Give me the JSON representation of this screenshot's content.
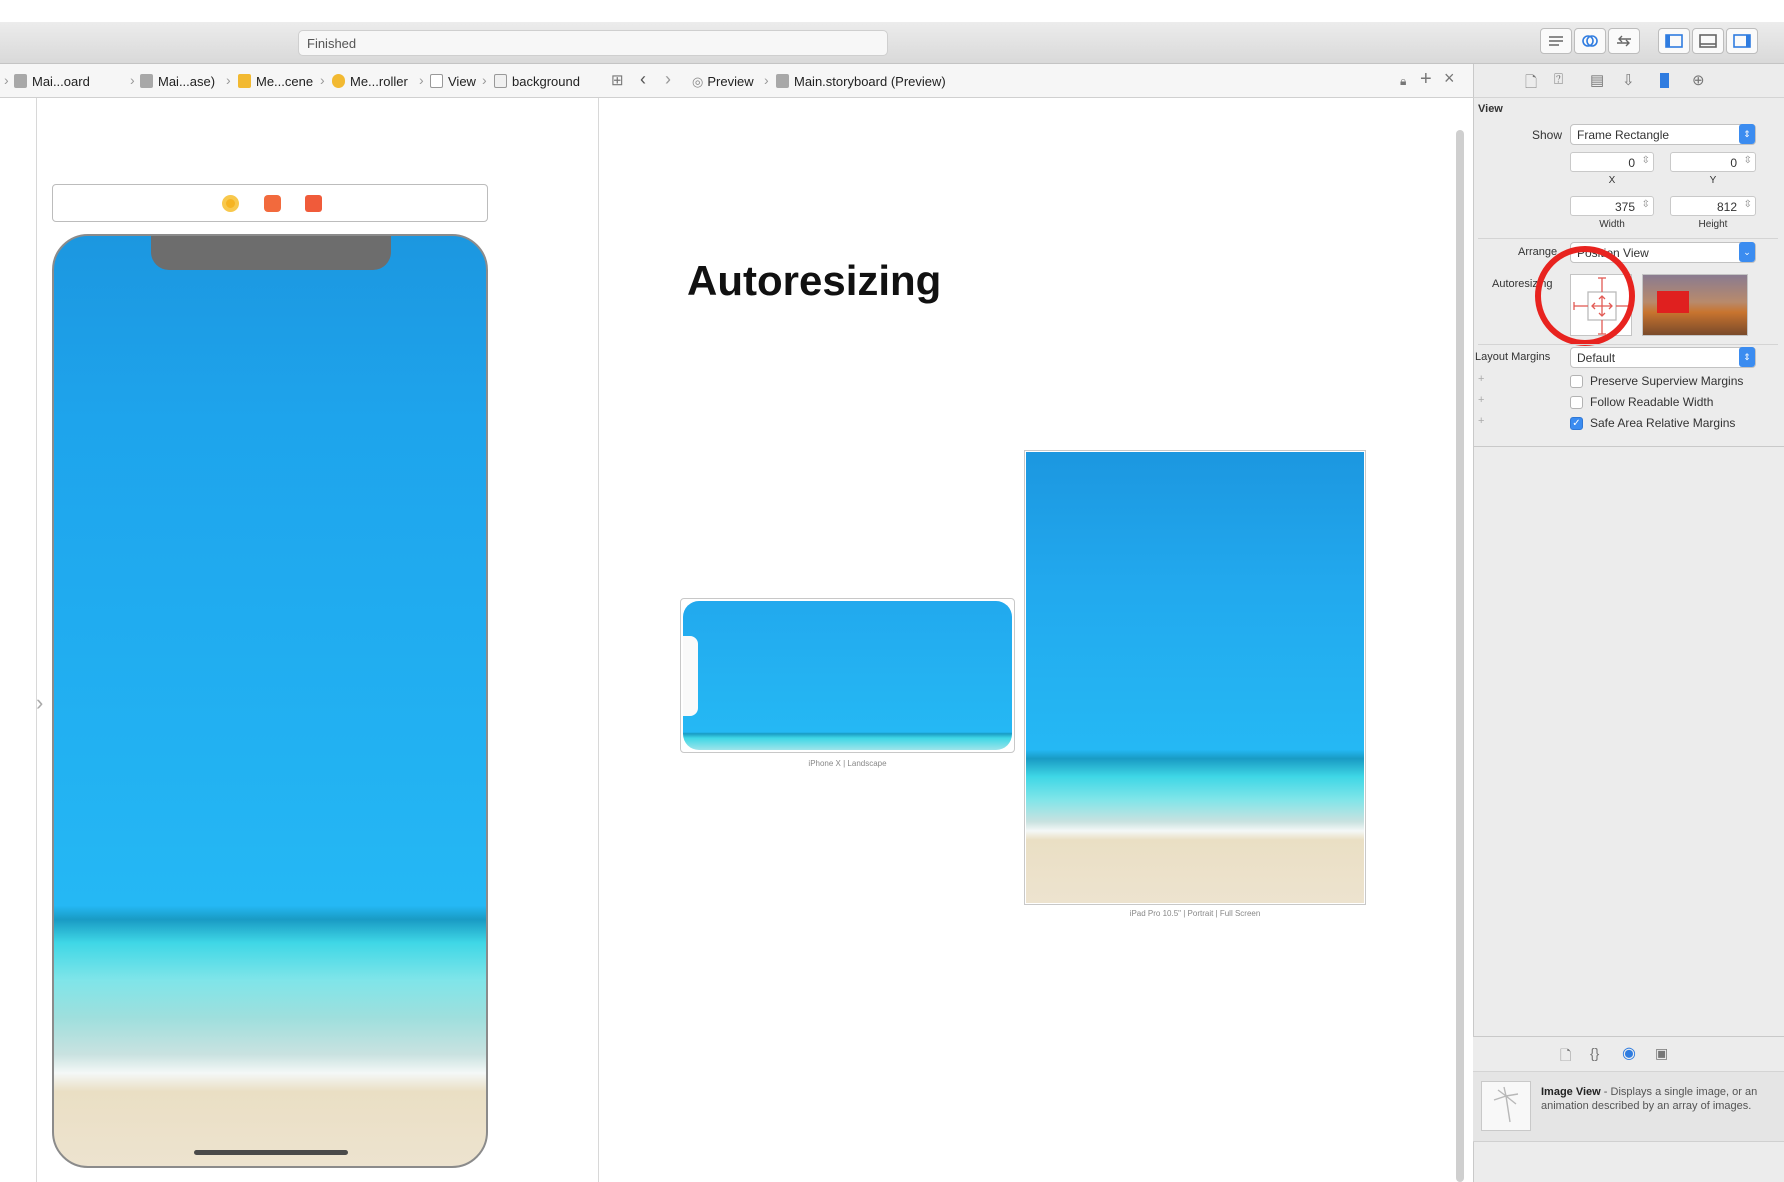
{
  "toolbar": {
    "activity_text": "Finished"
  },
  "jump_bar": {
    "crumbs": [
      "Mai...oard",
      "Mai...ase)",
      "Me...cene",
      "Me...roller",
      "View",
      "background"
    ],
    "assistant_crumbs": [
      "Preview",
      "Main.storyboard (Preview)"
    ]
  },
  "preview": {
    "heading": "Autoresizing",
    "devices": [
      {
        "caption": "iPhone X | Landscape"
      },
      {
        "caption": "iPad Pro 10.5\" | Portrait | Full Screen"
      }
    ]
  },
  "inspector": {
    "section_title": "View",
    "show_label": "Show",
    "show_value": "Frame Rectangle",
    "x_value": "0",
    "y_value": "0",
    "x_label": "X",
    "y_label": "Y",
    "width_value": "375",
    "height_value": "812",
    "width_label": "Width",
    "height_label": "Height",
    "arrange_label": "Arrange",
    "arrange_value": "Position View",
    "autoresizing_label": "Autoresizing",
    "layout_margins_label": "Layout Margins",
    "layout_margins_value": "Default",
    "checkboxes": [
      {
        "label": "Preserve Superview Margins",
        "checked": false
      },
      {
        "label": "Follow Readable Width",
        "checked": false
      },
      {
        "label": "Safe Area Relative Margins",
        "checked": true
      }
    ]
  },
  "library": {
    "item_title": "Image View",
    "item_description": " - Displays a single image, or an animation described by an array of images."
  },
  "colors": {
    "annotation": "#e8231f",
    "accent": "#3b8cf0"
  }
}
